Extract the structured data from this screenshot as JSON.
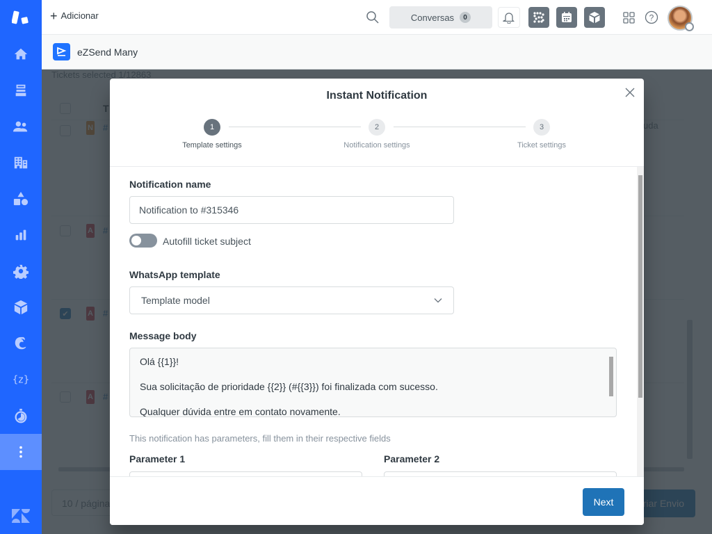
{
  "sidebar": {
    "items": [
      {
        "icon": "home-icon",
        "label": "Home"
      },
      {
        "icon": "views-icon",
        "label": "Views"
      },
      {
        "icon": "customers-icon",
        "label": "Customers"
      },
      {
        "icon": "organizations-icon",
        "label": "Organizations"
      },
      {
        "icon": "objects-icon",
        "label": "Objects"
      },
      {
        "icon": "reporting-icon",
        "label": "Reporting"
      },
      {
        "icon": "admin-icon",
        "label": "Admin"
      },
      {
        "icon": "apps-cube-icon",
        "label": "App"
      },
      {
        "icon": "mailchimp-icon",
        "label": "Mailchimp"
      },
      {
        "icon": "zendesk-curly-icon",
        "label": "Z app"
      },
      {
        "icon": "timer-icon",
        "label": "Timer"
      },
      {
        "icon": "more-icon",
        "label": "More",
        "active": true
      }
    ]
  },
  "topbar": {
    "add_label": "Adicionar",
    "conversations_label": "Conversas",
    "conversations_count": "0"
  },
  "app": {
    "name": "eZSend Many"
  },
  "background": {
    "tickets_selected": "Tickets selected 1/12863",
    "column_header": "T",
    "right_partial_text": "uda",
    "rows": [
      {
        "tag": "N",
        "tag_color": "#e07f1d",
        "checked": false
      },
      {
        "tag": "A",
        "tag_color": "#cc3340",
        "checked": false
      },
      {
        "tag": "A",
        "tag_color": "#cc3340",
        "checked": true
      },
      {
        "tag": "A",
        "tag_color": "#cc3340",
        "checked": false
      }
    ],
    "pager_label": "10 / página",
    "send_button": "Criar Envio"
  },
  "modal": {
    "title": "Instant Notification",
    "steps": [
      {
        "number": "1",
        "label": "Template settings",
        "active": true
      },
      {
        "number": "2",
        "label": "Notification settings",
        "active": false
      },
      {
        "number": "3",
        "label": "Ticket settings",
        "active": false
      }
    ],
    "notification_name_label": "Notification name",
    "notification_name_value": "Notification to #315346",
    "autofill_label": "Autofill ticket subject",
    "autofill_enabled": false,
    "whatsapp_template_label": "WhatsApp template",
    "whatsapp_template_value": "Template model",
    "message_body_label": "Message body",
    "message_body_lines": [
      "Olá {{1}}!",
      "Sua solicitação de prioridade {{2}} (#{{3}}) foi finalizada com sucesso.",
      "Qualquer dúvida entre em contato novamente."
    ],
    "params_hint": "This notification has parameters, fill them in their respective fields",
    "parameter_1_label": "Parameter 1",
    "parameter_2_label": "Parameter 2",
    "next_button": "Next"
  },
  "colors": {
    "sidebar": "#1f66ff",
    "primary_button": "#1f73b7"
  }
}
